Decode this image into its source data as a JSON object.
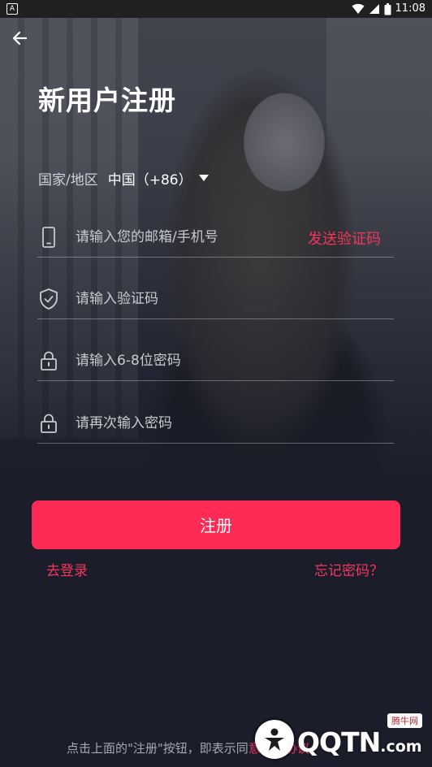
{
  "status_bar": {
    "time": "11:08",
    "left_icon": "A"
  },
  "header": {
    "back_icon": "arrow-left-icon",
    "title": "新用户注册"
  },
  "region": {
    "label": "国家/地区",
    "value": "中国（+86）"
  },
  "form": {
    "account_placeholder": "请输入您的邮箱/手机号",
    "send_code_label": "发送验证码",
    "code_placeholder": "请输入验证码",
    "password_placeholder": "请输入6-8位密码",
    "confirm_placeholder": "请再次输入密码"
  },
  "actions": {
    "register_label": "注册",
    "login_link": "去登录",
    "forgot_link": "忘记密码？"
  },
  "agreement": {
    "text_prefix": "点击上面的\"注册\"按钮，即表示同",
    "link_text": "意用户协议"
  },
  "watermark": {
    "brand": "QQTN",
    "suffix": ".com",
    "badge": "腾牛网"
  },
  "colors": {
    "accent": "#fd2a55",
    "link": "#f4365e",
    "background": "#1b1e2a"
  }
}
